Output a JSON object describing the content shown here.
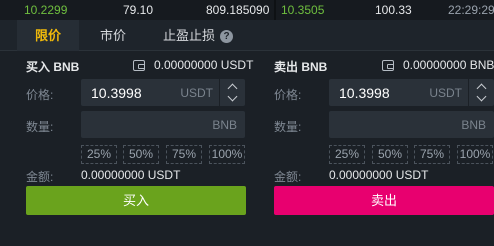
{
  "ticker": {
    "left": {
      "price": "10.2299",
      "change": "79.10",
      "volume": "809.185090"
    },
    "right": {
      "price": "10.3505",
      "change": "100.33",
      "time": "22:29:29"
    }
  },
  "tabs": [
    {
      "label": "限价",
      "active": true
    },
    {
      "label": "市价",
      "active": false
    },
    {
      "label": "止盈止损",
      "active": false,
      "icon": "question-icon"
    }
  ],
  "buy": {
    "header": "买入 BNB",
    "balance": "0.00000000 USDT",
    "price_label": "价格:",
    "price_value": "10.3998",
    "price_unit": "USDT",
    "amount_label": "数量:",
    "amount_unit": "BNB",
    "percents": [
      "25%",
      "50%",
      "75%",
      "100%"
    ],
    "total_label": "金额:",
    "total_value": "0.00000000 USDT",
    "button": "买入",
    "button_color": "#6aa31d"
  },
  "sell": {
    "header": "卖出 BNB",
    "balance": "0.00000000 BNB",
    "price_label": "价格:",
    "price_value": "10.3998",
    "price_unit": "USDT",
    "amount_label": "数量:",
    "amount_unit": "BNB",
    "percents": [
      "25%",
      "50%",
      "75%",
      "100%"
    ],
    "total_label": "金额:",
    "total_value": "0.00000000 USDT",
    "button": "卖出",
    "button_color": "#e8006f"
  },
  "colors": {
    "accent": "#f0b90b",
    "positive": "#6fbf3f",
    "background": "#1b2026"
  }
}
